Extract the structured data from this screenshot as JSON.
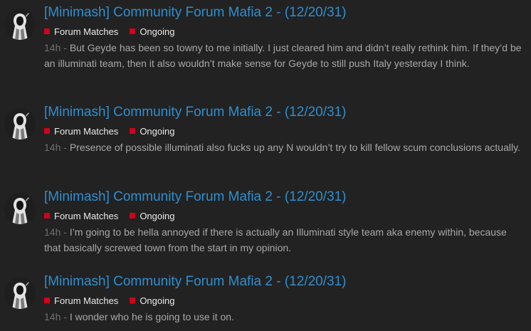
{
  "colors": {
    "background": "#222222",
    "title": "#2e8fcf",
    "tag_square": "#d0021b",
    "tag_text": "#e9e9e9",
    "body_text": "#a8a8a8",
    "timestamp": "#6f6f6f"
  },
  "posts": [
    {
      "avatar_icon": "hooded-figure-avatar",
      "title": "[Minimash] Community Forum Mafia 2 - (12/20/31)",
      "tags": [
        "Forum Matches",
        "Ongoing"
      ],
      "time": "14h",
      "separator": " - ",
      "text": "But Geyde has been so towny to me initially. I just cleared him and didn’t really rethink him. If they’d be an illuminati team, then it also wouldn’t make sense for Geyde to still push Italy yesterday I think."
    },
    {
      "avatar_icon": "hooded-figure-avatar",
      "title": "[Minimash] Community Forum Mafia 2 - (12/20/31)",
      "tags": [
        "Forum Matches",
        "Ongoing"
      ],
      "time": "14h",
      "separator": " - ",
      "text": "Presence of possible illuminati also fucks up any N wouldn’t try to kill fellow scum conclusions actually."
    },
    {
      "avatar_icon": "hooded-figure-avatar",
      "title": "[Minimash] Community Forum Mafia 2 - (12/20/31)",
      "tags": [
        "Forum Matches",
        "Ongoing"
      ],
      "time": "14h",
      "separator": " - ",
      "text": "I’m going to be hella annoyed if there is actually an Illuminati style team aka enemy within, because that basically screwed town from the start in my opinion."
    },
    {
      "avatar_icon": "hooded-figure-avatar",
      "title": "[Minimash] Community Forum Mafia 2 - (12/20/31)",
      "tags": [
        "Forum Matches",
        "Ongoing"
      ],
      "time": "14h",
      "separator": " - ",
      "text": "I wonder who he is going to use it on."
    }
  ]
}
